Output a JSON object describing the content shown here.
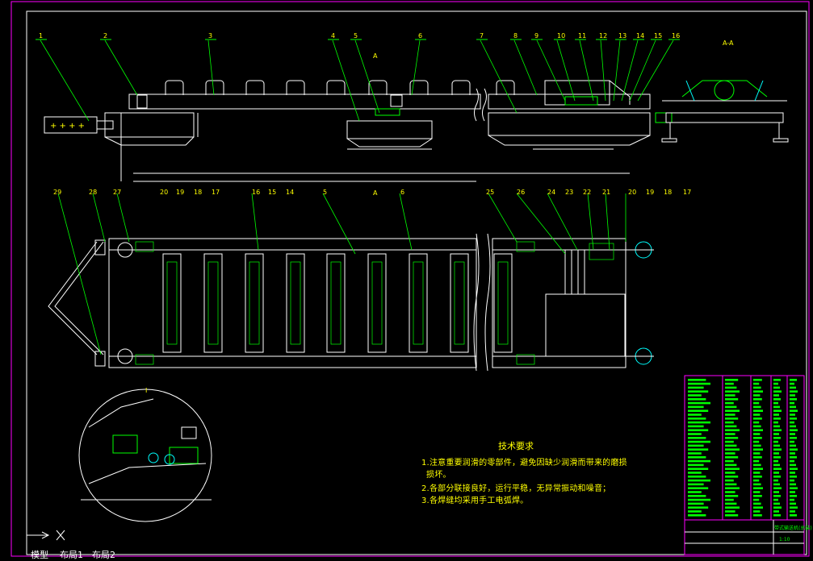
{
  "colors": {
    "background": "#000000",
    "border": "#ff00ff",
    "line": "#ffffff",
    "label": "#ffff00",
    "green": "#00ff00",
    "cyan": "#00ffff",
    "title_block_text": "#00ff00"
  },
  "top_view_labels": [
    "1",
    "2",
    "3",
    "4",
    "5",
    "6",
    "7",
    "8",
    "9",
    "10",
    "11",
    "12",
    "13",
    "14",
    "15",
    "16"
  ],
  "plan_view_top_labels": [
    "20",
    "19",
    "18",
    "17",
    "16",
    "15",
    "14",
    "5",
    "6",
    "25",
    "26",
    "24",
    "23",
    "22",
    "21",
    "20",
    "19",
    "18",
    "17"
  ],
  "plan_view_left_labels": [
    "29",
    "28",
    "27"
  ],
  "section_label": "A-A",
  "section_marks": [
    "A",
    "A"
  ],
  "detail_label": "I",
  "tech_requirements": {
    "title": "技术要求",
    "lines": [
      "1.注意重要润滑的零部件，避免因缺少润滑而带来的磨损",
      "损坏。",
      "2.各部分联接良好，运行平稳，无异常振动和噪音；",
      "3.各焊缝均采用手工电弧焊。"
    ]
  },
  "title_block": {
    "drawing_name": "带式输送机(总装)",
    "scale": "1:10"
  },
  "layout_tabs": {
    "model": "模型",
    "layout1": "布局1",
    "layout2": "布局2"
  },
  "axis_icon": "ucs-axis-icon"
}
